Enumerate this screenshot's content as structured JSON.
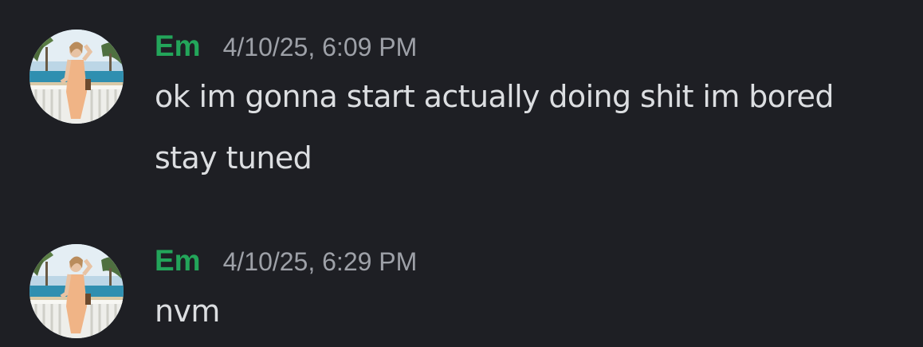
{
  "theme": {
    "background": "#1e1f24",
    "username_color": "#23a55a",
    "timestamp_color": "#9ea1a8",
    "text_color": "#dcdee1"
  },
  "messages": [
    {
      "author": "Em",
      "timestamp": "4/10/25, 6:09 PM",
      "avatar_icon": "user-avatar-photo",
      "lines": [
        "ok im gonna start actually doing shit im bored",
        "stay tuned"
      ]
    },
    {
      "author": "Em",
      "timestamp": "4/10/25, 6:29 PM",
      "avatar_icon": "user-avatar-photo",
      "lines": [
        "nvm"
      ]
    }
  ]
}
